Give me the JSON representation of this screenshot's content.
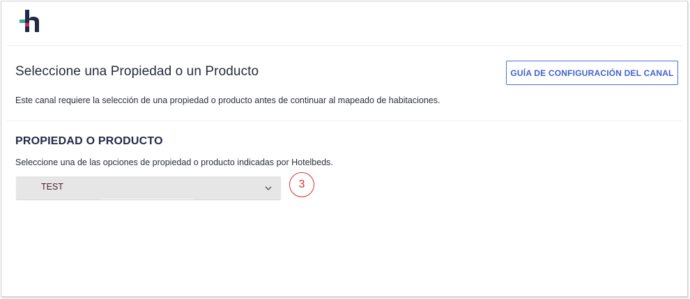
{
  "header": {
    "logo_icon": "hotelbeds-h-logo-icon",
    "logo_colors": {
      "dark": "#1f2a44",
      "green": "#3aa99f",
      "pink": "#c4305a"
    }
  },
  "main": {
    "title": "Seleccione una Propiedad o un Producto",
    "guide_button_label": "GUÍA DE CONFIGURACIÓN DEL CANAL",
    "intro": "Este canal requiere la selección de una propiedad o producto antes de continuar al mapeado de habitaciones."
  },
  "property_section": {
    "heading": "PROPIEDAD O PRODUCTO",
    "description": "Seleccione una de las opciones de propiedad o producto indicadas por Hotelbeds.",
    "select": {
      "value": "TEST",
      "icon": "chevron-down-icon"
    }
  },
  "annotation": {
    "step": "3",
    "color": "#d4302c"
  },
  "colors": {
    "accent": "#3f63cf",
    "select_bg": "#e6e6e6"
  }
}
